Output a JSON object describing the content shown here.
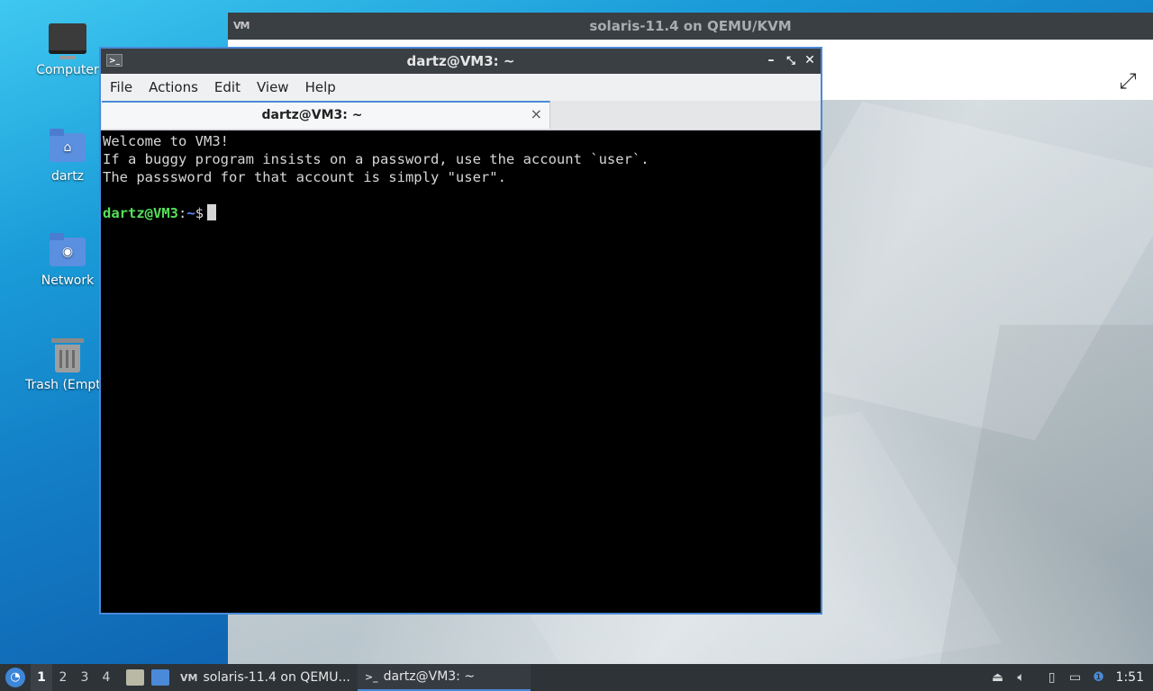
{
  "desktop": {
    "icons": [
      {
        "label": "Computer"
      },
      {
        "label": "dartz"
      },
      {
        "label": "Network"
      },
      {
        "label": "Trash (Empt"
      }
    ]
  },
  "vm_window": {
    "title": "solaris-11.4 on QEMU/KVM",
    "logo": "VM"
  },
  "terminal": {
    "title": "dartz@VM3: ~",
    "menu": [
      "File",
      "Actions",
      "Edit",
      "View",
      "Help"
    ],
    "tab_label": "dartz@VM3: ~",
    "tab_close": "×",
    "lines": [
      "Welcome to VM3!",
      "If a buggy program insists on a password, use the account `user`.",
      "The passsword for that account is simply \"user\"."
    ],
    "prompt": {
      "user_host": "dartz@VM3",
      "colon": ":",
      "path": "~",
      "symbol": "$"
    }
  },
  "taskbar": {
    "workspaces": [
      "1",
      "2",
      "3",
      "4"
    ],
    "active_workspace": "1",
    "tasks": [
      {
        "label": "solaris-11.4 on QEMU...",
        "icon": "VM"
      },
      {
        "label": "dartz@VM3: ~",
        "icon": ">_"
      }
    ],
    "clock": "1:51"
  },
  "colors": {
    "accent": "#4a8ad8",
    "prompt_user": "#55e05a",
    "prompt_path": "#5f8dff"
  }
}
